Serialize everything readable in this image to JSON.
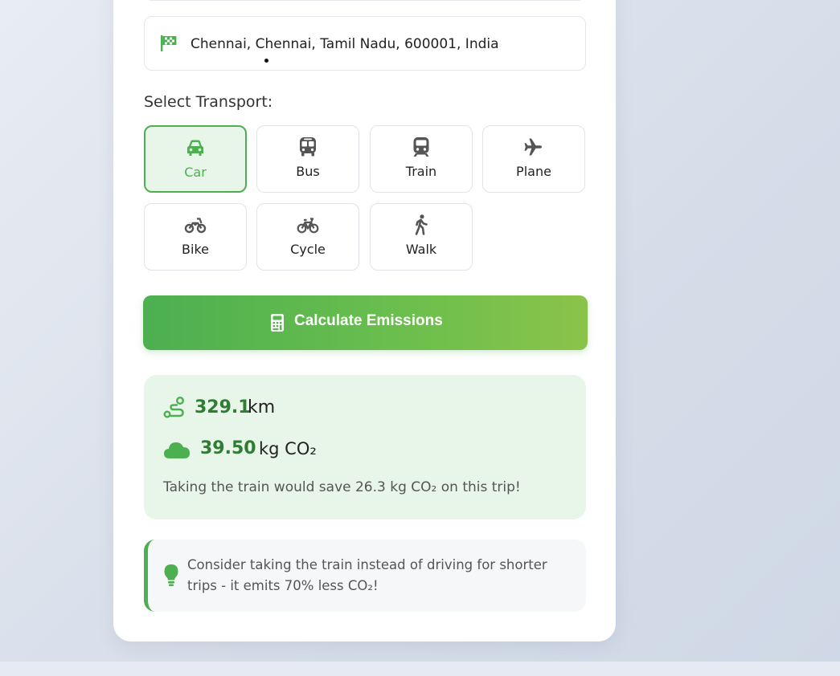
{
  "destination": {
    "value": "Chennai, Chennai, Tamil Nadu, 600001, India",
    "icon": "flag-checkered-icon"
  },
  "transport": {
    "label": "Select Transport:",
    "selected": "Car",
    "options": [
      {
        "label": "Car",
        "icon": "car-icon"
      },
      {
        "label": "Bus",
        "icon": "bus-icon"
      },
      {
        "label": "Train",
        "icon": "train-icon"
      },
      {
        "label": "Plane",
        "icon": "plane-icon"
      },
      {
        "label": "Bike",
        "icon": "motorcycle-icon"
      },
      {
        "label": "Cycle",
        "icon": "bicycle-icon"
      },
      {
        "label": "Walk",
        "icon": "walking-icon"
      }
    ]
  },
  "calculate": {
    "label": "Calculate Emissions",
    "icon": "calculator-icon"
  },
  "result": {
    "distance_value": "329.1",
    "distance_unit": "km",
    "co2_value": "39.50",
    "co2_unit": "kg CO₂",
    "saving_text": "Taking the train would save 26.3 kg CO₂ on this trip!"
  },
  "tip": {
    "text": "Consider taking the train instead of driving for shorter trips - it emits 70% less CO₂!",
    "icon": "lightbulb-icon"
  },
  "colors": {
    "accent": "#4caf50",
    "accent_dark": "#2e7d32",
    "accent_light": "#e8f5e9",
    "gradient_end": "#8bc34a",
    "icon_gray": "#555555"
  }
}
